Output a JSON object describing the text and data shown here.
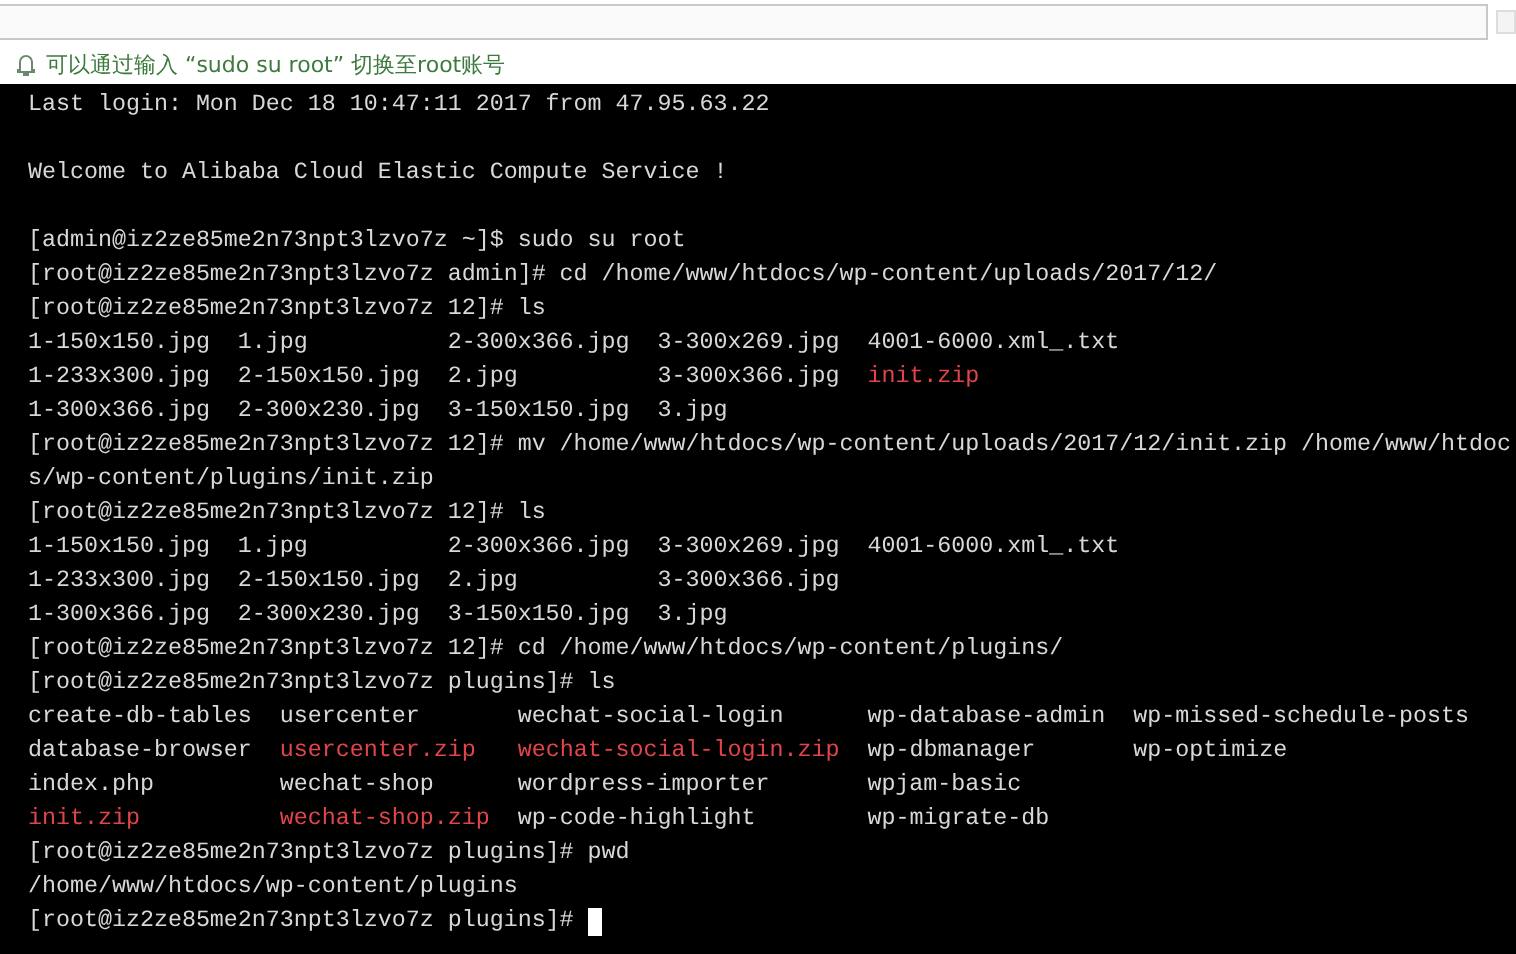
{
  "notice": {
    "text": "可以通过输入 “sudo su root” 切换至root账号"
  },
  "terminal": {
    "cursor": true,
    "lines": [
      {
        "segments": [
          {
            "text": "Last login: Mon Dec 18 10:47:11 2017 from 47.95.63.22",
            "kind": "plain"
          }
        ]
      },
      {
        "blank": true
      },
      {
        "segments": [
          {
            "text": "Welcome to Alibaba Cloud Elastic Compute Service !",
            "kind": "plain"
          }
        ]
      },
      {
        "blank": true
      },
      {
        "segments": [
          {
            "text": "[admin@iz2ze85me2n73npt3lzvo7z ~]$ sudo su root",
            "kind": "plain"
          }
        ]
      },
      {
        "segments": [
          {
            "text": "[root@iz2ze85me2n73npt3lzvo7z admin]# cd /home/www/htdocs/wp-content/uploads/2017/12/",
            "kind": "plain"
          }
        ]
      },
      {
        "segments": [
          {
            "text": "[root@iz2ze85me2n73npt3lzvo7z 12]# ls",
            "kind": "plain"
          }
        ]
      },
      {
        "segments": [
          {
            "text": "1-150x150.jpg  1.jpg          2-300x366.jpg  3-300x269.jpg  4001-6000.xml_.txt",
            "kind": "plain"
          }
        ]
      },
      {
        "segments": [
          {
            "text": "1-233x300.jpg  2-150x150.jpg  2.jpg          3-300x366.jpg  ",
            "kind": "plain"
          },
          {
            "text": "init.zip",
            "kind": "archive"
          }
        ]
      },
      {
        "segments": [
          {
            "text": "1-300x366.jpg  2-300x230.jpg  3-150x150.jpg  3.jpg",
            "kind": "plain"
          }
        ]
      },
      {
        "segments": [
          {
            "text": "[root@iz2ze85me2n73npt3lzvo7z 12]# mv /home/www/htdocs/wp-content/uploads/2017/12/init.zip /home/www/htdoc",
            "kind": "plain"
          }
        ]
      },
      {
        "segments": [
          {
            "text": "s/wp-content/plugins/init.zip",
            "kind": "plain"
          }
        ]
      },
      {
        "segments": [
          {
            "text": "[root@iz2ze85me2n73npt3lzvo7z 12]# ls",
            "kind": "plain"
          }
        ]
      },
      {
        "segments": [
          {
            "text": "1-150x150.jpg  1.jpg          2-300x366.jpg  3-300x269.jpg  4001-6000.xml_.txt",
            "kind": "plain"
          }
        ]
      },
      {
        "segments": [
          {
            "text": "1-233x300.jpg  2-150x150.jpg  2.jpg          3-300x366.jpg",
            "kind": "plain"
          }
        ]
      },
      {
        "segments": [
          {
            "text": "1-300x366.jpg  2-300x230.jpg  3-150x150.jpg  3.jpg",
            "kind": "plain"
          }
        ]
      },
      {
        "segments": [
          {
            "text": "[root@iz2ze85me2n73npt3lzvo7z 12]# cd /home/www/htdocs/wp-content/plugins/",
            "kind": "plain"
          }
        ]
      },
      {
        "segments": [
          {
            "text": "[root@iz2ze85me2n73npt3lzvo7z plugins]# ls",
            "kind": "plain"
          }
        ]
      },
      {
        "segments": [
          {
            "text": "create-db-tables  usercenter       wechat-social-login      wp-database-admin  wp-missed-schedule-posts",
            "kind": "plain"
          }
        ]
      },
      {
        "segments": [
          {
            "text": "database-browser  ",
            "kind": "plain"
          },
          {
            "text": "usercenter.zip   ",
            "kind": "archive"
          },
          {
            "text": "wechat-social-login.zip",
            "kind": "archive"
          },
          {
            "text": "  wp-dbmanager       wp-optimize",
            "kind": "plain"
          }
        ]
      },
      {
        "segments": [
          {
            "text": "index.php         wechat-shop      wordpress-importer       wpjam-basic",
            "kind": "plain"
          }
        ]
      },
      {
        "segments": [
          {
            "text": "init.zip          ",
            "kind": "archive"
          },
          {
            "text": "wechat-shop.zip",
            "kind": "archive"
          },
          {
            "text": "  wp-code-highlight        wp-migrate-db",
            "kind": "plain"
          }
        ]
      },
      {
        "segments": [
          {
            "text": "[root@iz2ze85me2n73npt3lzvo7z plugins]# pwd",
            "kind": "plain"
          }
        ]
      },
      {
        "segments": [
          {
            "text": "/home/www/htdocs/wp-content/plugins",
            "kind": "plain"
          }
        ]
      },
      {
        "segments": [
          {
            "text": "[root@iz2ze85me2n73npt3lzvo7z plugins]# ",
            "kind": "plain"
          }
        ]
      }
    ]
  }
}
